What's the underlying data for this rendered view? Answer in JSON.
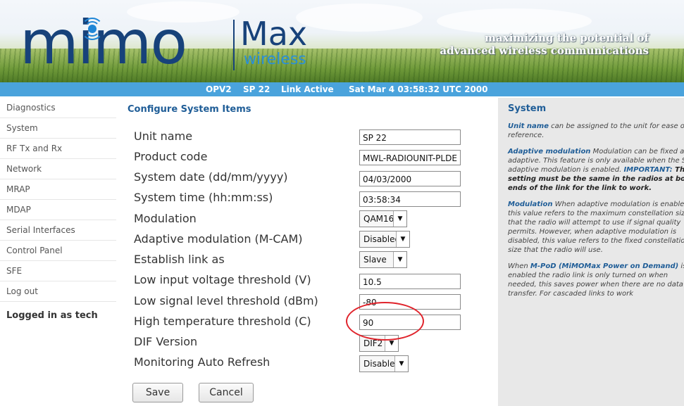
{
  "header": {
    "logo_mimo": "mimo",
    "logo_max": "Max",
    "logo_wireless": "wireless",
    "tagline_line1": "maximizing the potential of",
    "tagline_line2": "advanced wireless communications"
  },
  "status": {
    "unit_type": "OPV2",
    "unit_name": "SP 22",
    "link_state": "Link Active",
    "datetime": "Sat Mar 4 03:58:32 UTC 2000"
  },
  "sidebar": {
    "items": [
      "Diagnostics",
      "System",
      "RF Tx and Rx",
      "Network",
      "MRAP",
      "MDAP",
      "Serial Interfaces",
      "Control Panel",
      "SFE",
      "Log out"
    ],
    "logged_in": "Logged in as tech"
  },
  "form": {
    "title": "Configure System Items",
    "unit_name": {
      "label": "Unit name",
      "value": "SP 22"
    },
    "product_code": {
      "label": "Product code",
      "value": "MWL-RADIOUNIT-PLDE"
    },
    "system_date": {
      "label": "System date (dd/mm/yyyy)",
      "value": "04/03/2000"
    },
    "system_time": {
      "label": "System time (hh:mm:ss)",
      "value": "03:58:34"
    },
    "modulation": {
      "label": "Modulation",
      "value": "QAM16"
    },
    "adaptive_modulation": {
      "label": "Adaptive modulation (M-CAM)",
      "value": "Disabled"
    },
    "establish_link": {
      "label": "Establish link as",
      "value": "Slave"
    },
    "low_voltage": {
      "label": "Low input voltage threshold (V)",
      "value": "10.5"
    },
    "low_signal": {
      "label": "Low signal level threshold (dBm)",
      "value": "-80"
    },
    "high_temp": {
      "label": "High temperature threshold (C)",
      "value": "90"
    },
    "dif_version": {
      "label": "DIF Version",
      "value": "DIF2"
    },
    "auto_refresh": {
      "label": "Monitoring Auto Refresh",
      "value": "Disable"
    },
    "save_label": "Save",
    "cancel_label": "Cancel"
  },
  "help": {
    "title": "System",
    "p1_kw": "Unit name",
    "p1_text": " can be assigned to the unit for ease of reference.",
    "p2_kw": "Adaptive modulation",
    "p2_text": " Modulation can be fixed and adaptive. This feature is only available when the SFE adaptive modulation is enabled. ",
    "p2_imp_label": "IMPORTANT:",
    "p2_imp_text": " This setting must be the same in the radios at both ends of the link for the link to work.",
    "p3_kw": "Modulation",
    "p3_text": " When adaptive modulation is enabled, this value refers to the maximum constellation sizes that the radio will attempt to use if signal quality permits. However, when adaptive modulation is disabled, this value refers to the fixed constellation size that the radio will use.",
    "p4_pre": "When ",
    "p4_kw": "M-PoD (MiMOMax Power on Demand)",
    "p4_text": " is enabled the radio link is only turned on when needed, this saves power when there are no data to transfer. For cascaded links to work"
  },
  "colors": {
    "brand_blue": "#17427a",
    "accent_blue": "#1f5d97",
    "status_bar": "#4aa3dc",
    "highlight_circle": "#e0242c"
  }
}
